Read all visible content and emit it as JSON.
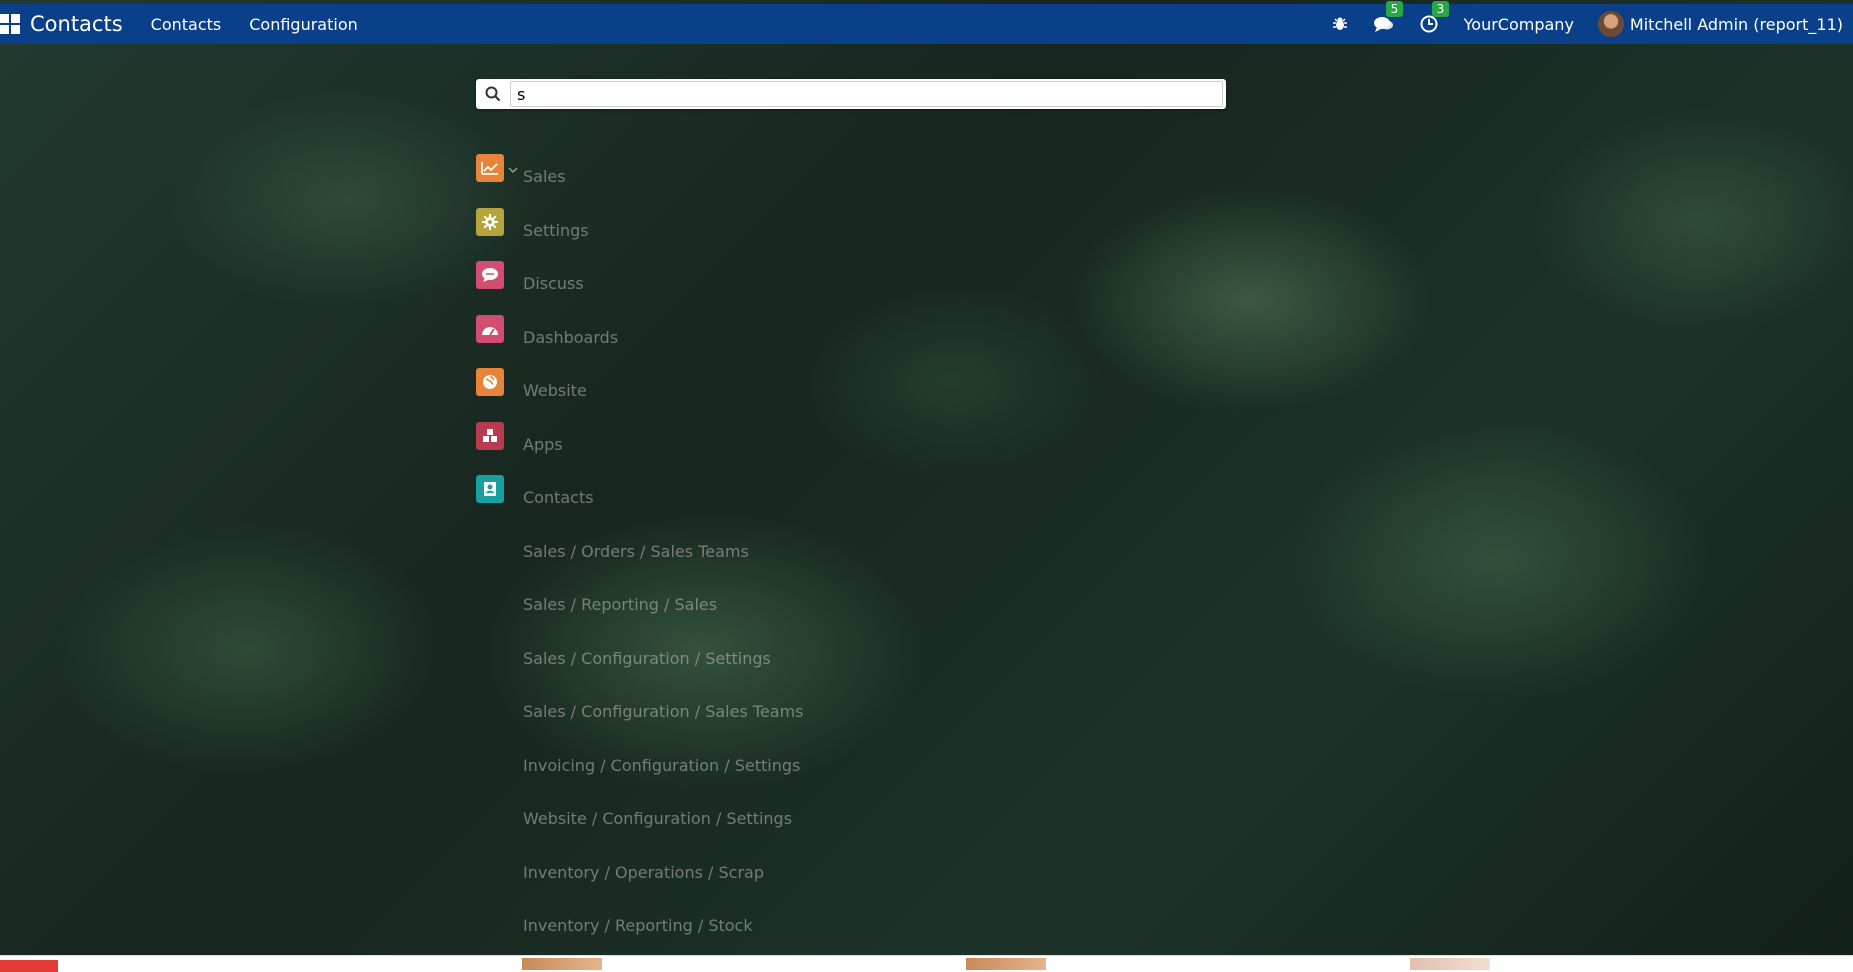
{
  "navbar": {
    "brand": "Contacts",
    "menu": [
      "Contacts",
      "Configuration"
    ],
    "messages_badge": "5",
    "activities_badge": "3",
    "company": "YourCompany",
    "user": "Mitchell Admin (report_11)"
  },
  "search": {
    "value": "s",
    "placeholder": ""
  },
  "results": [
    {
      "label": "Sales",
      "icon": "chart-icon",
      "color": "#e8833a"
    },
    {
      "label": "Settings",
      "icon": "gear-icon",
      "color": "#b5a43b"
    },
    {
      "label": "Discuss",
      "icon": "chat-icon",
      "color": "#d24d6f"
    },
    {
      "label": "Dashboards",
      "icon": "dashboard-icon",
      "color": "#d24d6f"
    },
    {
      "label": "Website",
      "icon": "globe-icon",
      "color": "#e8833a"
    },
    {
      "label": "Apps",
      "icon": "cubes-icon",
      "color": "#b83b4f"
    },
    {
      "label": "Contacts",
      "icon": "contact-card-icon",
      "color": "#1a9e9e"
    },
    {
      "label": "Sales / Orders / Sales Teams"
    },
    {
      "label": "Sales / Reporting / Sales"
    },
    {
      "label": "Sales / Configuration / Settings"
    },
    {
      "label": "Sales / Configuration / Sales Teams"
    },
    {
      "label": "Invoicing / Configuration / Settings"
    },
    {
      "label": "Website / Configuration / Settings"
    },
    {
      "label": "Inventory / Operations / Scrap"
    },
    {
      "label": "Inventory / Reporting / Stock"
    }
  ]
}
